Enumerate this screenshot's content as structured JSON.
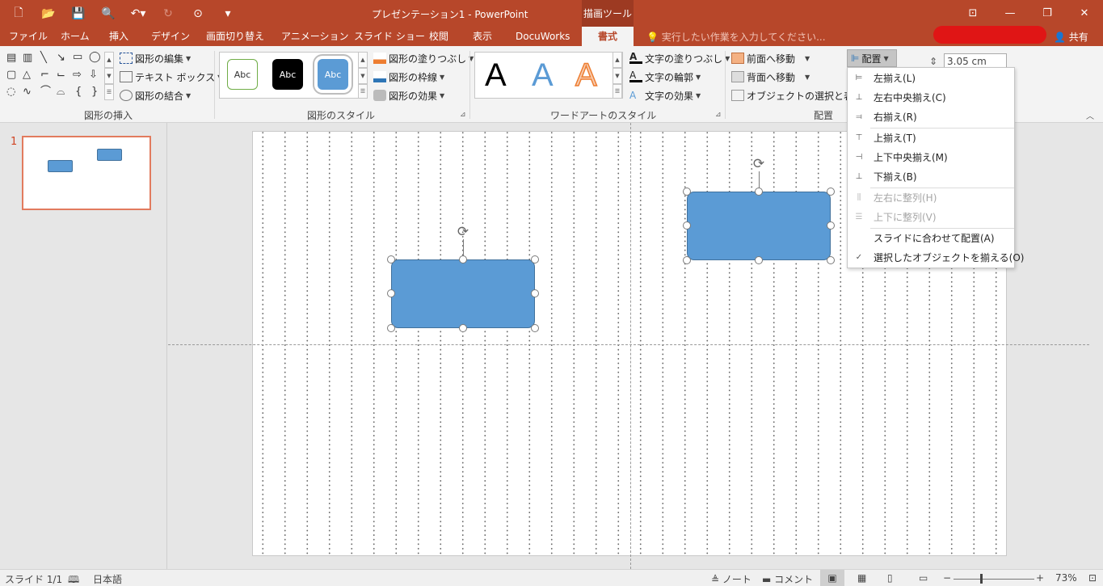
{
  "app": {
    "title": "プレゼンテーション1 - PowerPoint",
    "contextual_tool": "描画ツール",
    "share_label": "共有",
    "tell_me_placeholder": "実行したい作業を入力してください..."
  },
  "tabs": [
    "ファイル",
    "ホーム",
    "挿入",
    "デザイン",
    "画面切り替え",
    "アニメーション",
    "スライド ショー",
    "校閲",
    "表示",
    "DocuWorks",
    "書式"
  ],
  "active_tab": "書式",
  "ribbon": {
    "insert_shapes": {
      "label": "図形の挿入",
      "edit_shape": "図形の編集",
      "text_box": "テキスト ボックス",
      "merge_shapes": "図形の結合"
    },
    "shape_styles": {
      "label": "図形のスタイル",
      "swatches": [
        "Abc",
        "Abc",
        "Abc"
      ],
      "fill": "図形の塗りつぶし",
      "outline": "図形の枠線",
      "effects": "図形の効果"
    },
    "wordart": {
      "label": "ワードアートのスタイル",
      "samples": [
        "A",
        "A",
        "A"
      ],
      "text_fill": "文字の塗りつぶし",
      "text_outline": "文字の輪郭",
      "text_effects": "文字の効果"
    },
    "arrange": {
      "label": "配置",
      "bring_forward": "前面へ移動",
      "send_backward": "背面へ移動",
      "selection_pane": "オブジェクトの選択と表示",
      "align_button": "配置"
    },
    "size": {
      "height_value": "3.05 cm"
    }
  },
  "align_menu": {
    "items": [
      {
        "label": "左揃え(L)",
        "icon": "align-left-icon",
        "disabled": false
      },
      {
        "label": "左右中央揃え(C)",
        "icon": "align-center-icon",
        "disabled": false
      },
      {
        "label": "右揃え(R)",
        "icon": "align-right-icon",
        "disabled": false
      },
      {
        "label": "上揃え(T)",
        "icon": "align-top-icon",
        "disabled": false
      },
      {
        "label": "上下中央揃え(M)",
        "icon": "align-middle-icon",
        "disabled": false
      },
      {
        "label": "下揃え(B)",
        "icon": "align-bottom-icon",
        "disabled": false
      },
      {
        "label": "左右に整列(H)",
        "icon": "distribute-horizontal-icon",
        "disabled": true
      },
      {
        "label": "上下に整列(V)",
        "icon": "distribute-vertical-icon",
        "disabled": true
      },
      {
        "label": "スライドに合わせて配置(A)",
        "icon": "",
        "disabled": false
      },
      {
        "label": "選択したオブジェクトを揃える(O)",
        "icon": "checkmark-icon",
        "disabled": false
      }
    ]
  },
  "thumbnails": {
    "slide_number": "1"
  },
  "status": {
    "slide_indicator": "スライド 1/1",
    "language": "日本語",
    "notes": "ノート",
    "comments": "コメント",
    "zoom": "73%"
  },
  "colors": {
    "accent": "#b7472a",
    "shape_fill": "#5b9bd5",
    "shape_outline": "#41719c"
  }
}
